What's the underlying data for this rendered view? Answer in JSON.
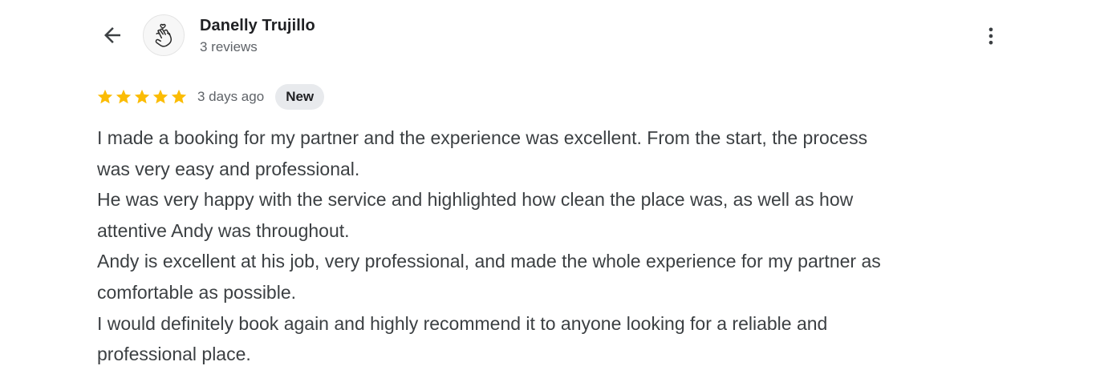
{
  "reviewer": {
    "name": "Danelly Trujillo",
    "review_count": "3 reviews",
    "avatar_icon": "hand-heart-gesture-icon"
  },
  "review": {
    "rating": 5,
    "max_rating": 5,
    "date": "3 days ago",
    "badge": "New",
    "lines": [
      "I made a booking for my partner and the experience was excellent. From the start, the process",
      "was very easy and professional.",
      "He was very happy with the service and highlighted how clean the place was, as well as how",
      "attentive Andy was throughout.",
      "Andy is excellent at his job, very professional, and made the whole experience for my partner as",
      "comfortable as possible.",
      "I would definitely book again and highly recommend it to anyone looking for a reliable and",
      "professional place."
    ]
  },
  "icons": {
    "back": "arrow-back-icon",
    "more": "more-vert-icon",
    "star": "star-icon"
  },
  "colors": {
    "star": "#fbbc04",
    "badge_bg": "#e8eaed",
    "text": "#3c4043",
    "secondary_text": "#5f6368"
  }
}
